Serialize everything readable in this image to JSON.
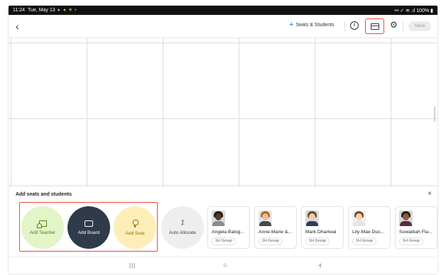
{
  "status_bar": {
    "time": "11:24",
    "date": "Tue, May 13",
    "notification_dots": "● ● ♥ •",
    "right_icons": "⚯ ✓ ≋ .ıl 100% ▮"
  },
  "toolbar": {
    "back_icon": "‹",
    "seats_plus": "+",
    "seats_label": "Seats & Students",
    "info_icon": "i",
    "gear_icon": "⚙",
    "save_label": "Save"
  },
  "panel": {
    "title": "Add seats and students",
    "close_icon": "×",
    "actions": [
      {
        "label": "Add Teacher"
      },
      {
        "label": "Add Board"
      },
      {
        "label": "Add Seat"
      },
      {
        "label": "Auto Allocate",
        "icon": "⁒"
      }
    ],
    "students": [
      {
        "name": "Angela Balog...",
        "group": "1H Group",
        "skin": "#5a3b26",
        "hair": "#1b1b1b",
        "shirt": "#8a8a8a",
        "bg": "#d9d9d9"
      },
      {
        "name": "Anne-Marie &...",
        "group": "1H Group",
        "skin": "#e8c0a0",
        "hair": "#b5651d",
        "shirt": "#4a4a4a",
        "bg": "#e6e6e6"
      },
      {
        "name": "Mark Dhariwal",
        "group": "1H Group",
        "skin": "#f0cdb0",
        "hair": "#6b4a2b",
        "shirt": "#2f3d5a",
        "bg": "#dadada"
      },
      {
        "name": "Lily-Mae Duc...",
        "group": "1H Group",
        "skin": "#f3d2b8",
        "hair": "#7a4b25",
        "shirt": "#e4e4e4",
        "bg": "#f0f0f0"
      },
      {
        "name": "Suwaibah Fla...",
        "group": "1H Group",
        "skin": "#8d5a3c",
        "hair": "#2a1a12",
        "shirt": "#5c2a3a",
        "bg": "#d7d7d7"
      }
    ]
  },
  "nav_bar": {
    "recents_icon": "|||",
    "home_icon": "○",
    "back_icon": "‹"
  }
}
